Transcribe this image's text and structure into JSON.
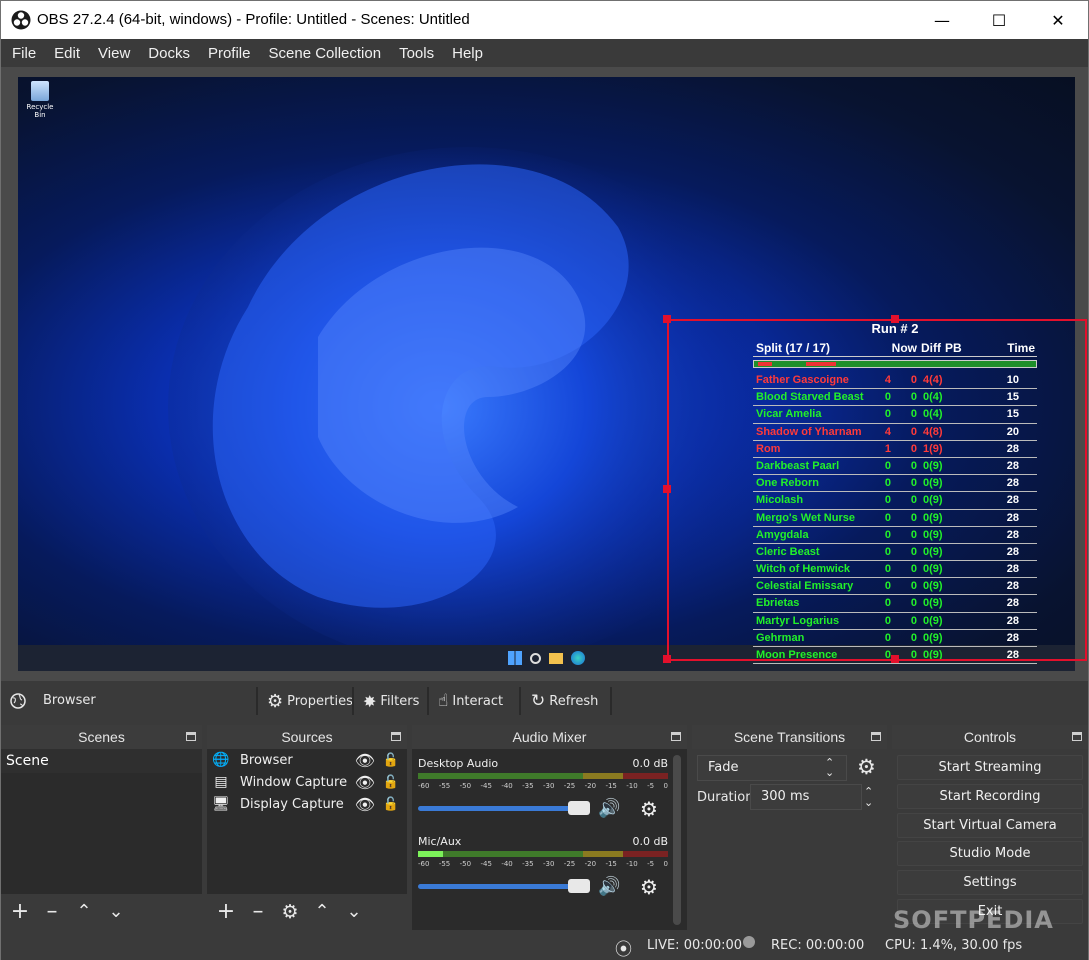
{
  "window": {
    "title": "OBS 27.2.4 (64-bit, windows) - Profile: Untitled - Scenes: Untitled"
  },
  "menu": [
    "File",
    "Edit",
    "View",
    "Docks",
    "Profile",
    "Scene Collection",
    "Tools",
    "Help"
  ],
  "preview": {
    "recycle_bin": "Recycle Bin",
    "splits": {
      "run_title": "Run # 2",
      "headers": {
        "split": "Split (17 / 17)",
        "now": "Now",
        "diff": "Diff",
        "pb": "PB",
        "time": "Time"
      },
      "rows": [
        {
          "name": "Father Gascoigne",
          "now": "4",
          "diff": "0",
          "pb": "4(4)",
          "time": "10",
          "color": "#ff3a3a"
        },
        {
          "name": "Blood Starved Beast",
          "now": "0",
          "diff": "0",
          "pb": "0(4)",
          "time": "15",
          "color": "#22f02a"
        },
        {
          "name": "Vicar Amelia",
          "now": "0",
          "diff": "0",
          "pb": "0(4)",
          "time": "15",
          "color": "#22f02a"
        },
        {
          "name": "Shadow of Yharnam",
          "now": "4",
          "diff": "0",
          "pb": "4(8)",
          "time": "20",
          "color": "#ff3a3a"
        },
        {
          "name": "Rom",
          "now": "1",
          "diff": "0",
          "pb": "1(9)",
          "time": "28",
          "color": "#ff3a3a"
        },
        {
          "name": "Darkbeast Paarl",
          "now": "0",
          "diff": "0",
          "pb": "0(9)",
          "time": "28",
          "color": "#22f02a"
        },
        {
          "name": "One Reborn",
          "now": "0",
          "diff": "0",
          "pb": "0(9)",
          "time": "28",
          "color": "#22f02a"
        },
        {
          "name": "Micolash",
          "now": "0",
          "diff": "0",
          "pb": "0(9)",
          "time": "28",
          "color": "#22f02a"
        },
        {
          "name": "Mergo's Wet Nurse",
          "now": "0",
          "diff": "0",
          "pb": "0(9)",
          "time": "28",
          "color": "#22f02a"
        },
        {
          "name": "Amygdala",
          "now": "0",
          "diff": "0",
          "pb": "0(9)",
          "time": "28",
          "color": "#22f02a"
        },
        {
          "name": "Cleric Beast",
          "now": "0",
          "diff": "0",
          "pb": "0(9)",
          "time": "28",
          "color": "#22f02a"
        },
        {
          "name": "Witch of Hemwick",
          "now": "0",
          "diff": "0",
          "pb": "0(9)",
          "time": "28",
          "color": "#22f02a"
        },
        {
          "name": "Celestial Emissary",
          "now": "0",
          "diff": "0",
          "pb": "0(9)",
          "time": "28",
          "color": "#22f02a"
        },
        {
          "name": "Ebrietas",
          "now": "0",
          "diff": "0",
          "pb": "0(9)",
          "time": "28",
          "color": "#22f02a"
        },
        {
          "name": "Martyr Logarius",
          "now": "0",
          "diff": "0",
          "pb": "0(9)",
          "time": "28",
          "color": "#22f02a"
        },
        {
          "name": "Gehrman",
          "now": "0",
          "diff": "0",
          "pb": "0(9)",
          "time": "28",
          "color": "#22f02a"
        },
        {
          "name": "Moon Presence",
          "now": "0",
          "diff": "0",
          "pb": "0(9)",
          "time": "28",
          "color": "#22f02a"
        }
      ]
    }
  },
  "source_toolbar": {
    "selected_source": "Browser",
    "properties": "Properties",
    "filters": "Filters",
    "interact": "Interact",
    "refresh": "Refresh"
  },
  "docks": {
    "scenes": {
      "title": "Scenes",
      "items": [
        "Scene"
      ]
    },
    "sources": {
      "title": "Sources",
      "items": [
        {
          "label": "Browser",
          "icon": "globe-icon"
        },
        {
          "label": "Window Capture",
          "icon": "window-icon"
        },
        {
          "label": "Display Capture",
          "icon": "monitor-icon"
        }
      ]
    },
    "mixer": {
      "title": "Audio Mixer",
      "ticks": [
        "-60",
        "-55",
        "-50",
        "-45",
        "-40",
        "-35",
        "-30",
        "-25",
        "-20",
        "-15",
        "-10",
        "-5",
        "0"
      ],
      "channels": [
        {
          "name": "Desktop Audio",
          "db": "0.0 dB"
        },
        {
          "name": "Mic/Aux",
          "db": "0.0 dB"
        }
      ]
    },
    "transitions": {
      "title": "Scene Transitions",
      "selected": "Fade",
      "duration_label": "Duration",
      "duration_value": "300 ms"
    },
    "controls": {
      "title": "Controls",
      "buttons": [
        "Start Streaming",
        "Start Recording",
        "Start Virtual Camera",
        "Studio Mode",
        "Settings",
        "Exit"
      ]
    }
  },
  "status": {
    "live": "LIVE: 00:00:00",
    "rec": "REC: 00:00:00",
    "cpu": "CPU: 1.4%, 30.00 fps"
  },
  "watermark": "SOFTPEDIA"
}
